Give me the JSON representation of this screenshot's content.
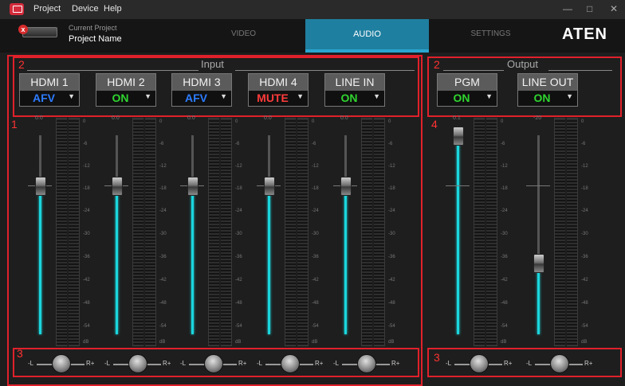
{
  "window": {
    "menu": [
      "Project",
      "Device",
      "Help"
    ],
    "controls": {
      "minimize": "—",
      "maximize": "□",
      "close": "✕"
    }
  },
  "header": {
    "project_label": "Current Project",
    "project_name": "Project Name",
    "error_badge": "x",
    "tabs": [
      {
        "label": "VIDEO",
        "active": false
      },
      {
        "label": "AUDIO",
        "active": true
      },
      {
        "label": "SETTINGS",
        "active": false
      }
    ],
    "brand": "ATEN"
  },
  "sections": {
    "input_title": "Input",
    "output_title": "Output"
  },
  "annotations": {
    "box1": "1",
    "box2_input": "2",
    "box2_output": "2",
    "box3_input": "3",
    "box3_output": "3",
    "box4": "4"
  },
  "channels": [
    {
      "name": "HDMI 1",
      "mode": "AFV",
      "mode_color": "#2d7cff",
      "top_level": "0.0",
      "fader_percent": 75
    },
    {
      "name": "HDMI 2",
      "mode": "ON",
      "mode_color": "#2fd52f",
      "top_level": "0.0",
      "fader_percent": 75
    },
    {
      "name": "HDMI 3",
      "mode": "AFV",
      "mode_color": "#2d7cff",
      "top_level": "0.0",
      "fader_percent": 75
    },
    {
      "name": "HDMI 4",
      "mode": "MUTE",
      "mode_color": "#ff3b3b",
      "top_level": "0.0",
      "fader_percent": 75
    },
    {
      "name": "LINE IN",
      "mode": "ON",
      "mode_color": "#2fd52f",
      "top_level": "0.0",
      "fader_percent": 75
    }
  ],
  "outputs": [
    {
      "name": "PGM",
      "mode": "ON",
      "mode_color": "#2fd52f",
      "top_level": "0.1",
      "fader_percent": 100
    },
    {
      "name": "LINE OUT",
      "mode": "ON",
      "mode_color": "#2fd52f",
      "top_level": "-20",
      "fader_percent": 36
    }
  ],
  "meter_scale": [
    "0",
    "-6",
    "-12",
    "-18",
    "-24",
    "-30",
    "-36",
    "-42",
    "-48",
    "-54",
    "dB"
  ],
  "pan": {
    "left_label": "-L",
    "right_label": "R+"
  }
}
